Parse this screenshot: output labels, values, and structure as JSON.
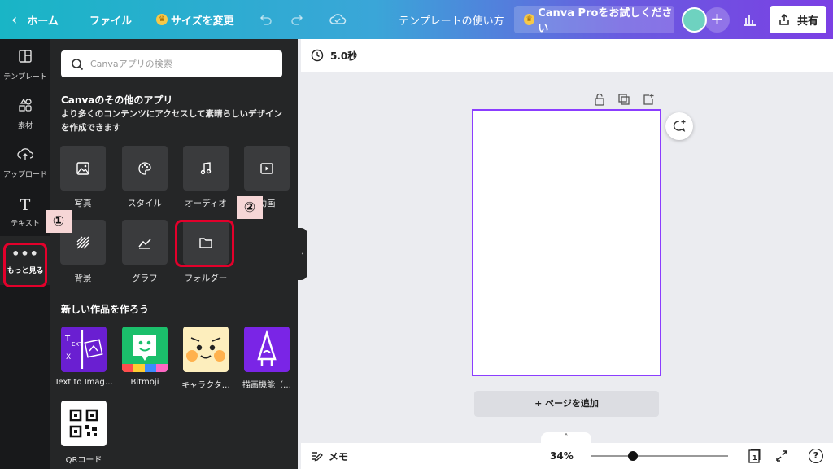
{
  "topbar": {
    "back_label": "ホーム",
    "file_label": "ファイル",
    "resize_label": "サイズを変更",
    "title": "テンプレートの使い方",
    "pro_button": "Canva Proをお試しください",
    "share_label": "共有"
  },
  "rail": {
    "items": [
      {
        "label": "テンプレート",
        "icon": "template-icon"
      },
      {
        "label": "素材",
        "icon": "elements-icon"
      },
      {
        "label": "アップロード",
        "icon": "upload-icon"
      },
      {
        "label": "テキスト",
        "icon": "text-icon"
      },
      {
        "label": "もっと見る",
        "icon": "more-icon"
      }
    ]
  },
  "panel": {
    "search_placeholder": "Canvaアプリの検索",
    "section_title": "Canvaのその他のアプリ",
    "section_desc": "より多くのコンテンツにアクセスして素晴らしいデザインを作成できます",
    "apps": [
      {
        "label": "写真",
        "icon": "photo-icon"
      },
      {
        "label": "スタイル",
        "icon": "palette-icon"
      },
      {
        "label": "オーディオ",
        "icon": "music-icon"
      },
      {
        "label": "動画",
        "icon": "video-icon"
      },
      {
        "label": "背景",
        "icon": "background-icon"
      },
      {
        "label": "グラフ",
        "icon": "chart-icon"
      },
      {
        "label": "フォルダー",
        "icon": "folder-icon"
      }
    ],
    "create_title": "新しい作品を作ろう",
    "create_items": [
      {
        "label": "Text to Imag…"
      },
      {
        "label": "Bitmoji"
      },
      {
        "label": "キャラクタ…"
      },
      {
        "label": "描画機能（…"
      },
      {
        "label": "QRコード"
      }
    ]
  },
  "annotations": {
    "callout_1": "①",
    "callout_2": "②",
    "highlight_color": "#e3002b"
  },
  "editor": {
    "duration": "5.0秒",
    "add_page": "+ ページを追加",
    "notes_label": "メモ",
    "zoom": "34%",
    "zoom_fraction": 0.34,
    "page_count": "1",
    "help": "?"
  }
}
